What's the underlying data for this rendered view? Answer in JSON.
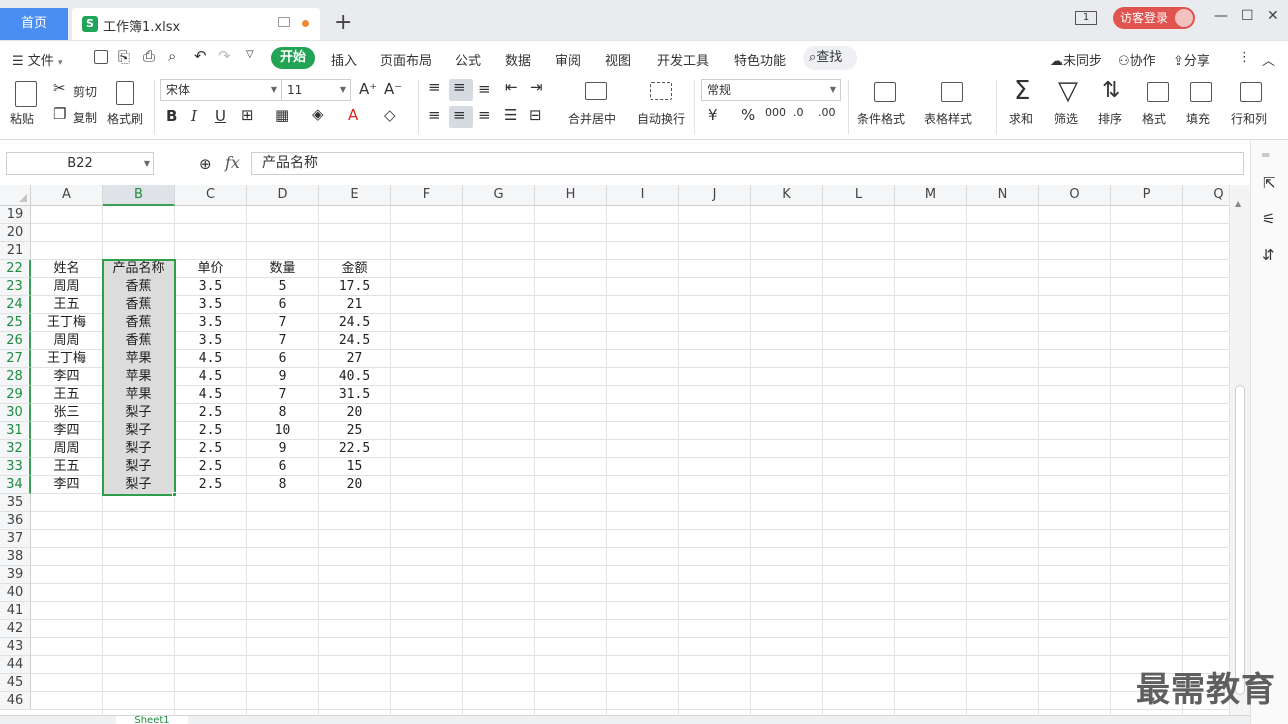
{
  "titlebar": {
    "home_tab": "首页",
    "doc_tab": "工作簿1.xlsx",
    "doc_icon": "S",
    "add_tab": "+",
    "page_badge": "1",
    "login": "访客登录",
    "minimize": "—",
    "maximize": "☐",
    "close": "✕"
  },
  "menubar": {
    "file": "文件",
    "items": [
      "开始",
      "插入",
      "页面布局",
      "公式",
      "数据",
      "审阅",
      "视图",
      "开发工具",
      "特色功能"
    ],
    "search": "查找",
    "sync": "未同步",
    "collab": "协作",
    "share": "分享"
  },
  "ribbon": {
    "paste": "粘贴",
    "cut": "剪切",
    "copy": "复制",
    "format_painter": "格式刷",
    "font_name": "宋体",
    "font_size": "11",
    "merge_center": "合并居中",
    "wrap_text": "自动换行",
    "number_format": "常规",
    "conditional_format": "条件格式",
    "table_style": "表格样式",
    "sum": "求和",
    "filter": "筛选",
    "sort": "排序",
    "format": "格式",
    "fill": "填充",
    "row_col": "行和列"
  },
  "formula_bar": {
    "name_box": "B22",
    "fx": "fx",
    "value": "产品名称"
  },
  "grid": {
    "columns": [
      "A",
      "B",
      "C",
      "D",
      "E",
      "F",
      "G",
      "H",
      "I",
      "J",
      "K",
      "L",
      "M",
      "N",
      "O",
      "P",
      "Q"
    ],
    "selected_column": "B",
    "first_row": 19,
    "last_row": 46,
    "header_row": 22,
    "headers": [
      "姓名",
      "产品名称",
      "单价",
      "数量",
      "金额"
    ],
    "rows": [
      [
        "周周",
        "香蕉",
        "3.5",
        "5",
        "17.5"
      ],
      [
        "王五",
        "香蕉",
        "3.5",
        "6",
        "21"
      ],
      [
        "王丁梅",
        "香蕉",
        "3.5",
        "7",
        "24.5"
      ],
      [
        "周周",
        "香蕉",
        "3.5",
        "7",
        "24.5"
      ],
      [
        "王丁梅",
        "苹果",
        "4.5",
        "6",
        "27"
      ],
      [
        "李四",
        "苹果",
        "4.5",
        "9",
        "40.5"
      ],
      [
        "王五",
        "苹果",
        "4.5",
        "7",
        "31.5"
      ],
      [
        "张三",
        "梨子",
        "2.5",
        "8",
        "20"
      ],
      [
        "李四",
        "梨子",
        "2.5",
        "10",
        "25"
      ],
      [
        "周周",
        "梨子",
        "2.5",
        "9",
        "22.5"
      ],
      [
        "王五",
        "梨子",
        "2.5",
        "6",
        "15"
      ],
      [
        "李四",
        "梨子",
        "2.5",
        "8",
        "20"
      ]
    ]
  },
  "sheet_tab": "Sheet1",
  "watermark": "最需教育",
  "colors": {
    "accent_green": "#23a455",
    "home_tab_blue": "#4b8ef3",
    "login_red": "#e0534e",
    "selection_border": "#2e9e4c"
  }
}
